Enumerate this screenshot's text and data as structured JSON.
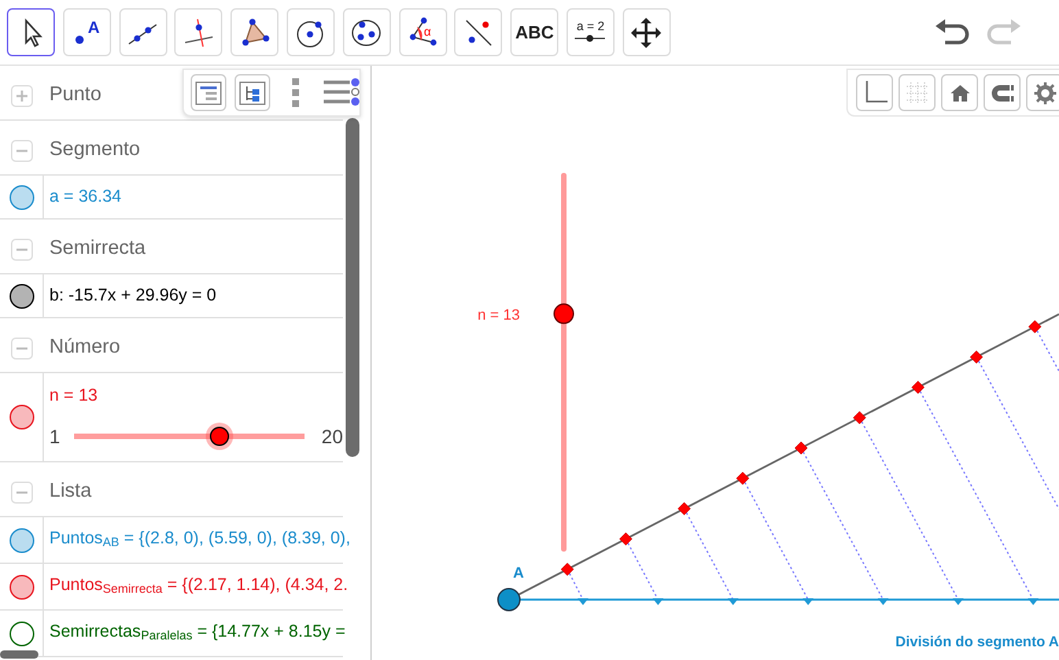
{
  "toolbar": {
    "tools": [
      {
        "kind": "move",
        "selected": true
      },
      {
        "kind": "point",
        "label": "A",
        "selected": false
      },
      {
        "kind": "line",
        "selected": false
      },
      {
        "kind": "perpendicular",
        "selected": false
      },
      {
        "kind": "polygon",
        "selected": false
      },
      {
        "kind": "circle",
        "selected": false
      },
      {
        "kind": "conic",
        "selected": false
      },
      {
        "kind": "angle",
        "label": "α",
        "selected": false
      },
      {
        "kind": "reflect",
        "selected": false
      },
      {
        "kind": "text",
        "label": "ABC",
        "selected": false
      },
      {
        "kind": "slider",
        "label": "a = 2",
        "selected": false
      },
      {
        "kind": "pan",
        "selected": false
      }
    ],
    "undo": {
      "disabled": false
    },
    "redo": {
      "disabled": true
    }
  },
  "algebra": {
    "groups": [
      {
        "title": "Punto",
        "expanded": false
      },
      {
        "title": "Segmento",
        "expanded": true,
        "items": [
          {
            "kind": "formula",
            "text": "a = 36.34",
            "color": "#1a8ccc",
            "shown": true
          }
        ]
      },
      {
        "title": "Semirrecta",
        "expanded": true,
        "items": [
          {
            "kind": "formula",
            "text": "b: -15.7x + 29.96y = 0",
            "color": "#000000",
            "shown": true
          }
        ]
      },
      {
        "title": "Número",
        "expanded": true,
        "items": [
          {
            "kind": "slider",
            "text": "n = 13",
            "min": "1",
            "max": "20",
            "level": 0.63,
            "color": "#e8141e",
            "shown": true
          }
        ]
      },
      {
        "title": "Lista",
        "expanded": true,
        "items": [
          {
            "kind": "formula",
            "text": "Puntos$_{AB}$ = {(2.8, 0), (5.59, 0), (8.39, 0),",
            "color": "#1a8ccc",
            "shown": true
          },
          {
            "kind": "formula",
            "text": "Puntos$_{Semirrecta}$ = {(2.17, 1.14), (4.34, 2.",
            "color": "#e8141e",
            "shown": true
          },
          {
            "kind": "formula",
            "text": "Semirrectas$_{Paralelas}$ = {14.77x + 8.15y =",
            "color": "#006400",
            "shown": false
          }
        ]
      }
    ]
  },
  "graphics": {
    "style_bar": {
      "axes_on": true,
      "grid_on": false
    },
    "slider": {
      "label": "n = 13",
      "level": 0.63
    },
    "point_label": "A",
    "caption": "División do segmento A"
  }
}
